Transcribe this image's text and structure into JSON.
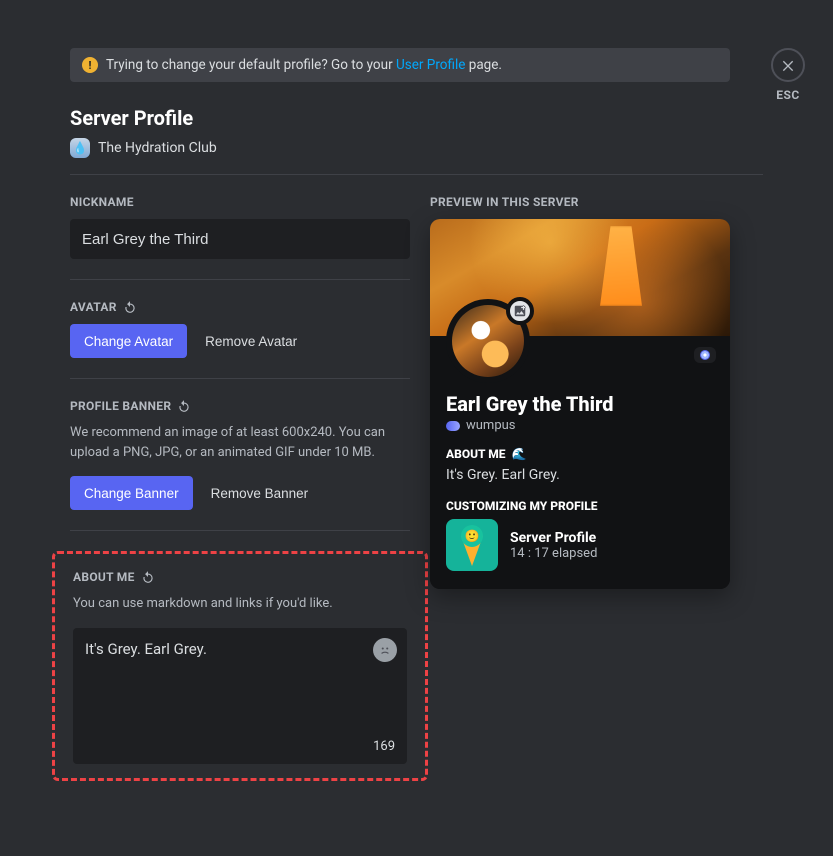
{
  "notice": {
    "text_before": "Trying to change your default profile? Go to your ",
    "link_text": "User Profile",
    "text_after": " page."
  },
  "title": "Server Profile",
  "server": {
    "name": "The Hydration Club"
  },
  "nickname": {
    "label": "NICKNAME",
    "value": "Earl Grey the Third"
  },
  "avatar": {
    "label": "AVATAR",
    "change": "Change Avatar",
    "remove": "Remove Avatar"
  },
  "banner": {
    "label": "PROFILE BANNER",
    "helper": "We recommend an image of at least 600x240. You can upload a PNG, JPG, or an animated GIF under 10 MB.",
    "change": "Change Banner",
    "remove": "Remove Banner"
  },
  "about": {
    "label": "ABOUT ME",
    "helper": "You can use markdown and links if you'd like.",
    "value": "It's Grey. Earl Grey.",
    "char_count": "169"
  },
  "preview": {
    "label": "PREVIEW IN THIS SERVER",
    "display_name": "Earl Grey the Third",
    "handle": "wumpus",
    "about_label": "ABOUT ME",
    "about_text": "It's Grey. Earl Grey.",
    "activity_label": "CUSTOMIZING MY PROFILE",
    "activity_title": "Server Profile",
    "activity_elapsed": "14 : 17 elapsed"
  },
  "close": {
    "label": "ESC"
  },
  "emoji": {
    "about_water": "🌊",
    "face": "😙"
  }
}
